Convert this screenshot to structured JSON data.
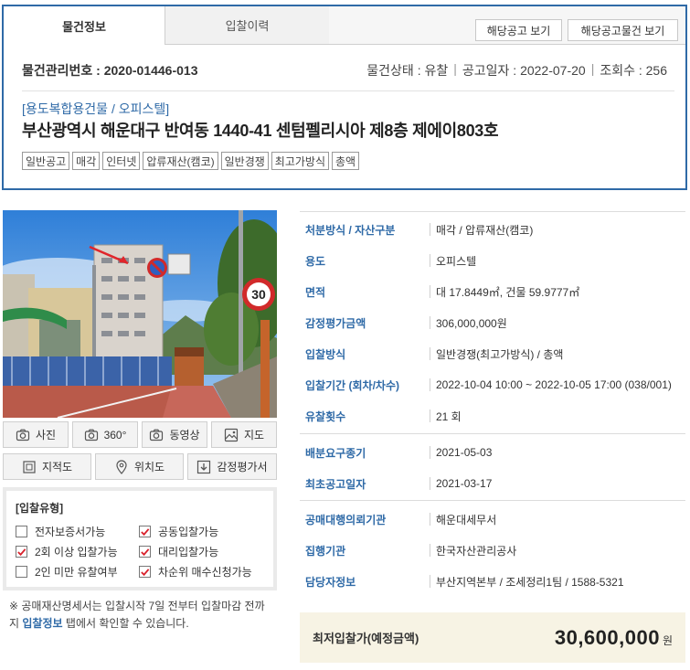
{
  "tabs": {
    "active": "물건정보",
    "inactive": "입찰이력"
  },
  "header_buttons": {
    "notice": "해당공고 보기",
    "notice_items": "해당공고물건 보기"
  },
  "meta": {
    "item_number": "물건관리번호 : 2020-01446-013",
    "status": "물건상태 : 유찰",
    "notice_date": "공고일자 : 2022-07-20",
    "views": "조회수 : 256"
  },
  "property": {
    "usage": "[용도복합용건물 / 오피스텔]",
    "address": "부산광역시 해운대구 반여동 1440-41 센텀펠리시아 제8층 제에이803호",
    "tags": [
      "일반공고",
      "매각",
      "인터넷",
      "압류재산(캠코)",
      "일반경쟁",
      "최고가방식",
      "총액"
    ]
  },
  "media_buttons": {
    "photo": "사진",
    "view360": "360°",
    "video": "동영상",
    "map": "지도",
    "cadastral": "지적도",
    "location": "위치도",
    "appraisal": "감정평가서"
  },
  "bid_types": {
    "title": "[입찰유형]",
    "items": [
      {
        "label": "전자보증서가능",
        "checked": false
      },
      {
        "label": "공동입찰가능",
        "checked": true
      },
      {
        "label": "2회 이상 입찰가능",
        "checked": true
      },
      {
        "label": "대리입찰가능",
        "checked": true
      },
      {
        "label": "2인 미만 유찰여부",
        "checked": false
      },
      {
        "label": "차순위 매수신청가능",
        "checked": true
      }
    ]
  },
  "note": {
    "text1": "※ 공매재산명세서는 입찰시작 7일 전부터 입찰마감 전까지",
    "link": "입찰정보",
    "text2": "탭에서 확인할 수 있습니다."
  },
  "info": {
    "disposal": {
      "key": "처분방식 / 자산구분",
      "value": "매각 / 압류재산(캠코)"
    },
    "use": {
      "key": "용도",
      "value": "오피스텔"
    },
    "area": {
      "key": "면적",
      "value": "대 17.8449㎡, 건물 59.9777㎡"
    },
    "appraisal": {
      "key": "감정평가금액",
      "value": "306,000,000원"
    },
    "bid_method": {
      "key": "입찰방식",
      "value": "일반경쟁(최고가방식) / 총액"
    },
    "bid_period": {
      "key": "입찰기간 (회차/차수)",
      "value": "2022-10-04 10:00 ~ 2022-10-05 17:00 (038/001)"
    },
    "fail_count": {
      "key": "유찰횟수",
      "value": "21 회"
    },
    "dist_deadline": {
      "key": "배분요구종기",
      "value": "2021-05-03"
    },
    "first_notice": {
      "key": "최초공고일자",
      "value": "2021-03-17"
    },
    "agency": {
      "key": "공매대행의뢰기관",
      "value": "해운대세무서"
    },
    "executor": {
      "key": "집행기관",
      "value": "한국자산관리공사"
    },
    "manager": {
      "key": "담당자정보",
      "value": "부산지역본부 / 조세정리1팀 / 1588-5321"
    }
  },
  "min_price": {
    "label": "최저입찰가(예정금액)",
    "value": "30,600,000",
    "unit": "원"
  },
  "photo_sign": "30",
  "colors": {
    "accent": "#2f6aa7",
    "check": "#d9232e",
    "price_bg": "#f7f3e4"
  }
}
